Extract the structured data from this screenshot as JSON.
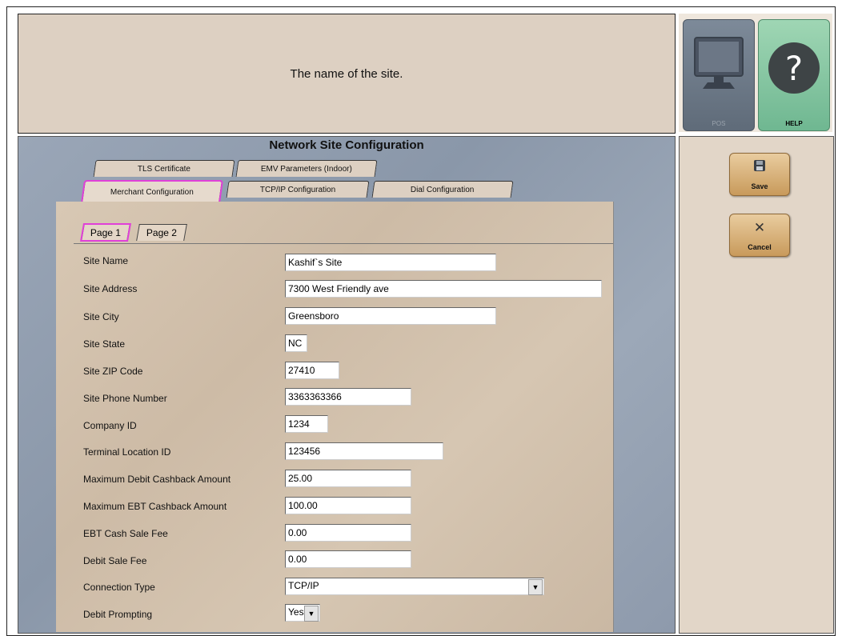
{
  "help_text": "The name of the site.",
  "icons": {
    "pos": {
      "label": "POS",
      "icon": "monitor-icon"
    },
    "help": {
      "label": "HELP",
      "icon": "question-icon"
    }
  },
  "window_title": "Network Site Configuration",
  "tabs": {
    "tls": "TLS Certificate",
    "emv": "EMV Parameters (Indoor)",
    "merchant": "Merchant Configuration",
    "tcpip": "TCP/IP Configuration",
    "dial": "Dial Configuration"
  },
  "subtabs": {
    "page1": "Page 1",
    "page2": "Page 2"
  },
  "fields": [
    {
      "label": "Site Name",
      "value": "Kashif`s Site"
    },
    {
      "label": "Site Address",
      "value": "7300 West Friendly ave"
    },
    {
      "label": "Site City",
      "value": "Greensboro"
    },
    {
      "label": "Site State",
      "value": "NC"
    },
    {
      "label": "Site ZIP Code",
      "value": "27410"
    },
    {
      "label": "Site Phone Number",
      "value": "3363363366"
    },
    {
      "label": "Company ID",
      "value": "1234"
    },
    {
      "label": "Terminal Location ID",
      "value": "123456"
    },
    {
      "label": "Maximum Debit Cashback Amount",
      "value": "25.00"
    },
    {
      "label": "Maximum EBT Cashback Amount",
      "value": "100.00"
    },
    {
      "label": "EBT Cash Sale Fee",
      "value": "0.00"
    },
    {
      "label": "Debit Sale Fee",
      "value": "0.00"
    },
    {
      "label": "Connection Type",
      "value": "TCP/IP"
    },
    {
      "label": "Debit Prompting",
      "value": "Yes"
    }
  ],
  "actions": {
    "save": {
      "label": "Save",
      "icon": "floppy-icon"
    },
    "cancel": {
      "label": "Cancel",
      "icon": "x-icon"
    }
  },
  "colors": {
    "accent_highlight": "#e040d8",
    "button": "#d9b27c",
    "panel": "#ddd0c2"
  }
}
